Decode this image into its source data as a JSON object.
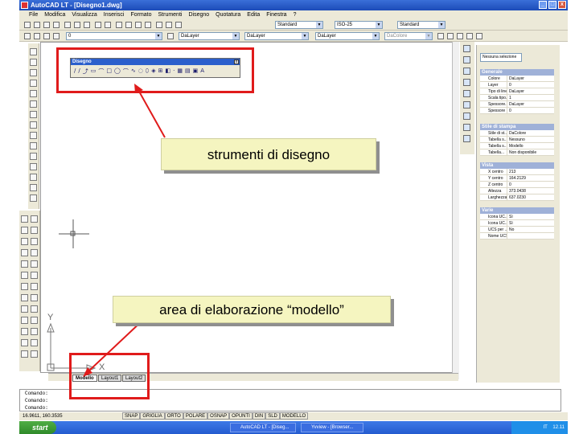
{
  "window": {
    "title": "AutoCAD LT - [Disegno1.dwg]",
    "buttons": [
      "_",
      "□",
      "x"
    ]
  },
  "menu": [
    "File",
    "Modifica",
    "Visualizza",
    "Inserisci",
    "Formato",
    "Strumenti",
    "Disegno",
    "Quotatura",
    "Edita",
    "Finestra",
    "?"
  ],
  "toolbars": {
    "text_style": "Standard",
    "dim_style": "ISO-25",
    "table_style": "Standard",
    "layer": "0",
    "color": "DaLayer",
    "linetype": "DaLayer",
    "lineweight": "DaLayer",
    "plotstyle": "DaColore"
  },
  "disegno_toolbar": {
    "title": "Disegno",
    "icons": [
      "/",
      "/",
      "⤴",
      "▭",
      "⌒",
      "□",
      "◯",
      "⌒",
      "∿",
      "◌",
      "⬯",
      "◈",
      "⊞",
      "◧",
      "·",
      "▦",
      "▤",
      "▣",
      "A"
    ],
    "close": "x"
  },
  "drawing": {
    "ucs_y": "Y",
    "ucs_x": "X",
    "tabs": [
      "Modello",
      "Layout1",
      "Layout2"
    ]
  },
  "properties": {
    "combo": "Nessuna selezione",
    "sections": [
      {
        "title": "Generale",
        "rows": [
          [
            "Colore",
            "DaLayer"
          ],
          [
            "Layer",
            "0"
          ],
          [
            "Tipo di linea",
            "DaLayer"
          ],
          [
            "Scala tipo...",
            "1"
          ],
          [
            "Spessore...",
            "DaLayer"
          ],
          [
            "Spessore",
            "0"
          ]
        ]
      },
      {
        "title": "Stile di stampa",
        "rows": [
          [
            "Stile di st...",
            "DaColore"
          ],
          [
            "Tabella s...",
            "Nessuno"
          ],
          [
            "Tabella s...",
            "Modello"
          ],
          [
            "Tabella...",
            "Non disponibile"
          ]
        ]
      },
      {
        "title": "Vista",
        "rows": [
          [
            "X centro",
            "213"
          ],
          [
            "Y centro",
            "164.2129"
          ],
          [
            "Z centro",
            "0"
          ],
          [
            "Altezza",
            "373.0438"
          ],
          [
            "Larghezza",
            "637.0230"
          ]
        ]
      },
      {
        "title": "Varie",
        "rows": [
          [
            "Icona UC...",
            "Sì"
          ],
          [
            "Icona UC...",
            "Sì"
          ],
          [
            "UCS per ...",
            "No"
          ],
          [
            "Nome UCS",
            ""
          ]
        ]
      }
    ]
  },
  "command_lines": [
    "Comando:",
    "Comando:",
    "Comando:"
  ],
  "status": {
    "coords": "16.9611, 160.3535",
    "modes": [
      "SNAP",
      "GRIGLIA",
      "ORTO",
      "POLARE",
      "OSNAP",
      "OPUNTI",
      "DIN",
      "SLD",
      "MODELLO"
    ]
  },
  "taskbar": {
    "start": "start",
    "tasks": [
      "AutoCAD LT - [Diseg...",
      "Yvview - [Browser..."
    ],
    "tray_lang": "IT",
    "clock": "12.11"
  },
  "annotations": {
    "tools_label": "strumenti di disegno",
    "area_label": "area di elaborazione “modello”",
    "accent": "#e01b1b"
  }
}
